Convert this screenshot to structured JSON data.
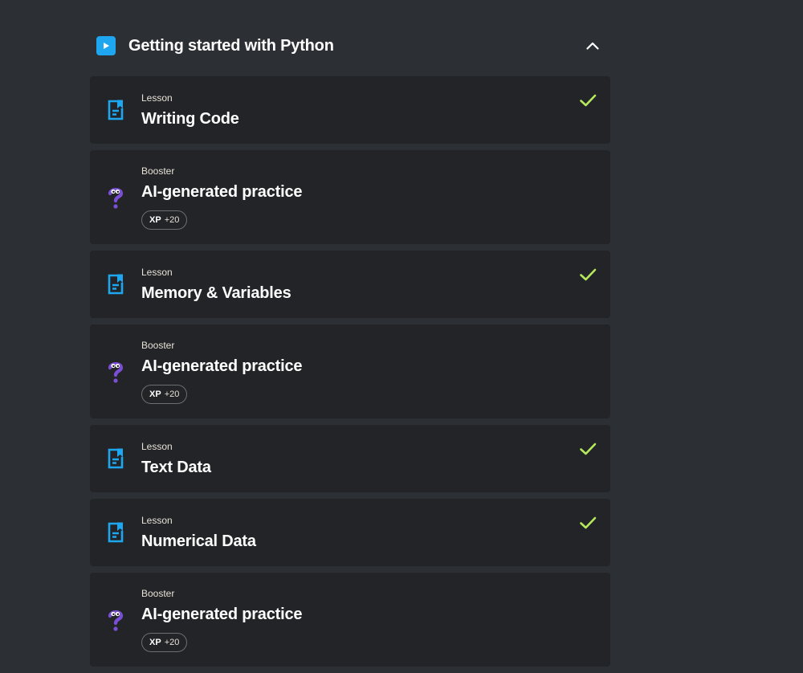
{
  "chapter": {
    "title": "Getting started with Python"
  },
  "items": [
    {
      "type": "Lesson",
      "title": "Writing Code",
      "completed": true
    },
    {
      "type": "Booster",
      "title": "AI-generated practice",
      "xp_label": "XP",
      "xp_value": "+20"
    },
    {
      "type": "Lesson",
      "title": "Memory & Variables",
      "completed": true
    },
    {
      "type": "Booster",
      "title": "AI-generated practice",
      "xp_label": "XP",
      "xp_value": "+20"
    },
    {
      "type": "Lesson",
      "title": "Text Data",
      "completed": true
    },
    {
      "type": "Lesson",
      "title": "Numerical Data",
      "completed": true
    },
    {
      "type": "Booster",
      "title": "AI-generated practice",
      "xp_label": "XP",
      "xp_value": "+20"
    }
  ],
  "colors": {
    "background": "#2c2f33",
    "card": "#222427",
    "accent_blue": "#1ea7f0",
    "check_green": "#b5e85c",
    "booster_purple": "#7a4fd6"
  },
  "icons": {
    "chapter": "play-icon",
    "collapse": "chevron-up-icon",
    "lesson": "document-bookmark-icon",
    "booster": "question-mark-mascot-icon",
    "completed": "check-icon"
  }
}
